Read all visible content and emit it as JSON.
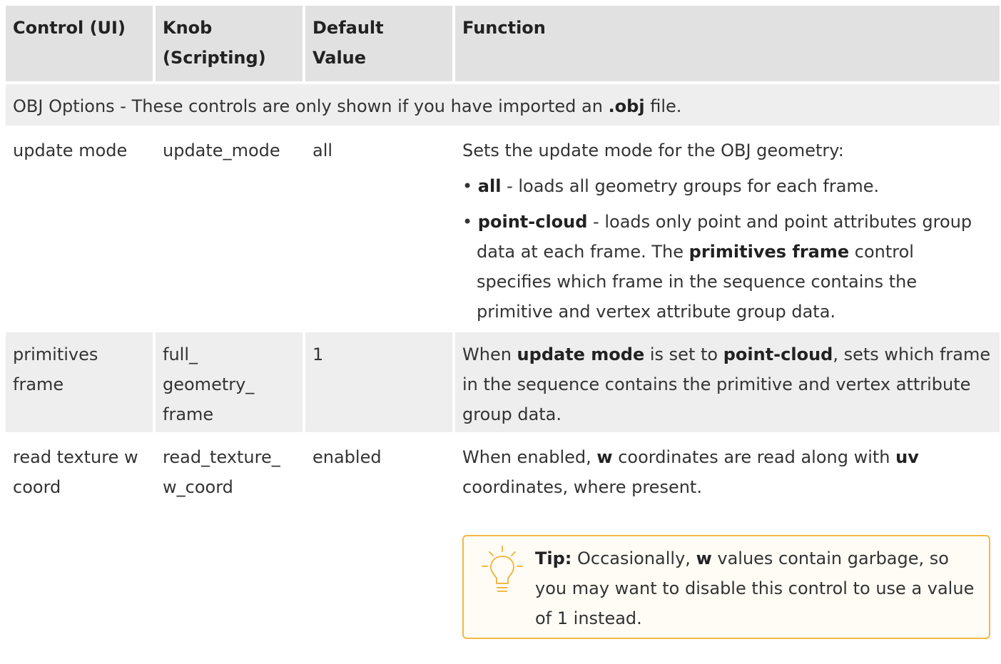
{
  "header": {
    "col1": "Control (UI)",
    "col2_line1": "Knob",
    "col2_line2": "(Scripting)",
    "col3_line1": "Default",
    "col3_line2": "Value",
    "col4": "Function"
  },
  "section": {
    "prefix": "OBJ Options - These controls are only shown if you have imported an ",
    "bold": ".obj",
    "suffix": " file."
  },
  "rows": {
    "update_mode": {
      "control": "update mode",
      "knob": "update_mode",
      "default": "all",
      "intro": "Sets the update mode for the OBJ geometry:",
      "b1_bold": "all",
      "b1_text": " - loads all geometry groups for each frame.",
      "b2_bold": "point-cloud",
      "b2_text1": " - loads only point and point attributes group data at each frame. The ",
      "b2_bold2": "primitives frame",
      "b2_text2": " control specifies which frame in the sequence contains the primitive and vertex attribute group data."
    },
    "primitives_frame": {
      "control": "primitives frame",
      "knob_line1": "full_",
      "knob_line2": "geometry_",
      "knob_line3": "frame",
      "default": "1",
      "t1": "When ",
      "bold1": "update mode",
      "t2": " is set to ",
      "bold2": "point-cloud",
      "t3": ", sets which frame in the sequence contains the primitive and vertex attribute group data."
    },
    "read_texture": {
      "control": "read texture w coord",
      "knob_line1": "read_texture_",
      "knob_line2": "w_coord",
      "default": "enabled",
      "t1": "When enabled, ",
      "bold1": "w",
      "t2": " coordinates are read along with ",
      "bold2": "uv",
      "t3": " coordinates, where present.",
      "tip_label": "Tip:",
      "tip_t1": "  Occasionally, ",
      "tip_bold": "w",
      "tip_t2": " values contain garbage, so you may want to disable this control to use a value of 1 instead."
    }
  },
  "colors": {
    "header_bg": "#e1e1e1",
    "shaded_bg": "#eeeeee",
    "tip_border": "#f3b843",
    "text": "#333333"
  },
  "icons": {
    "tip": "lightbulb-icon"
  }
}
